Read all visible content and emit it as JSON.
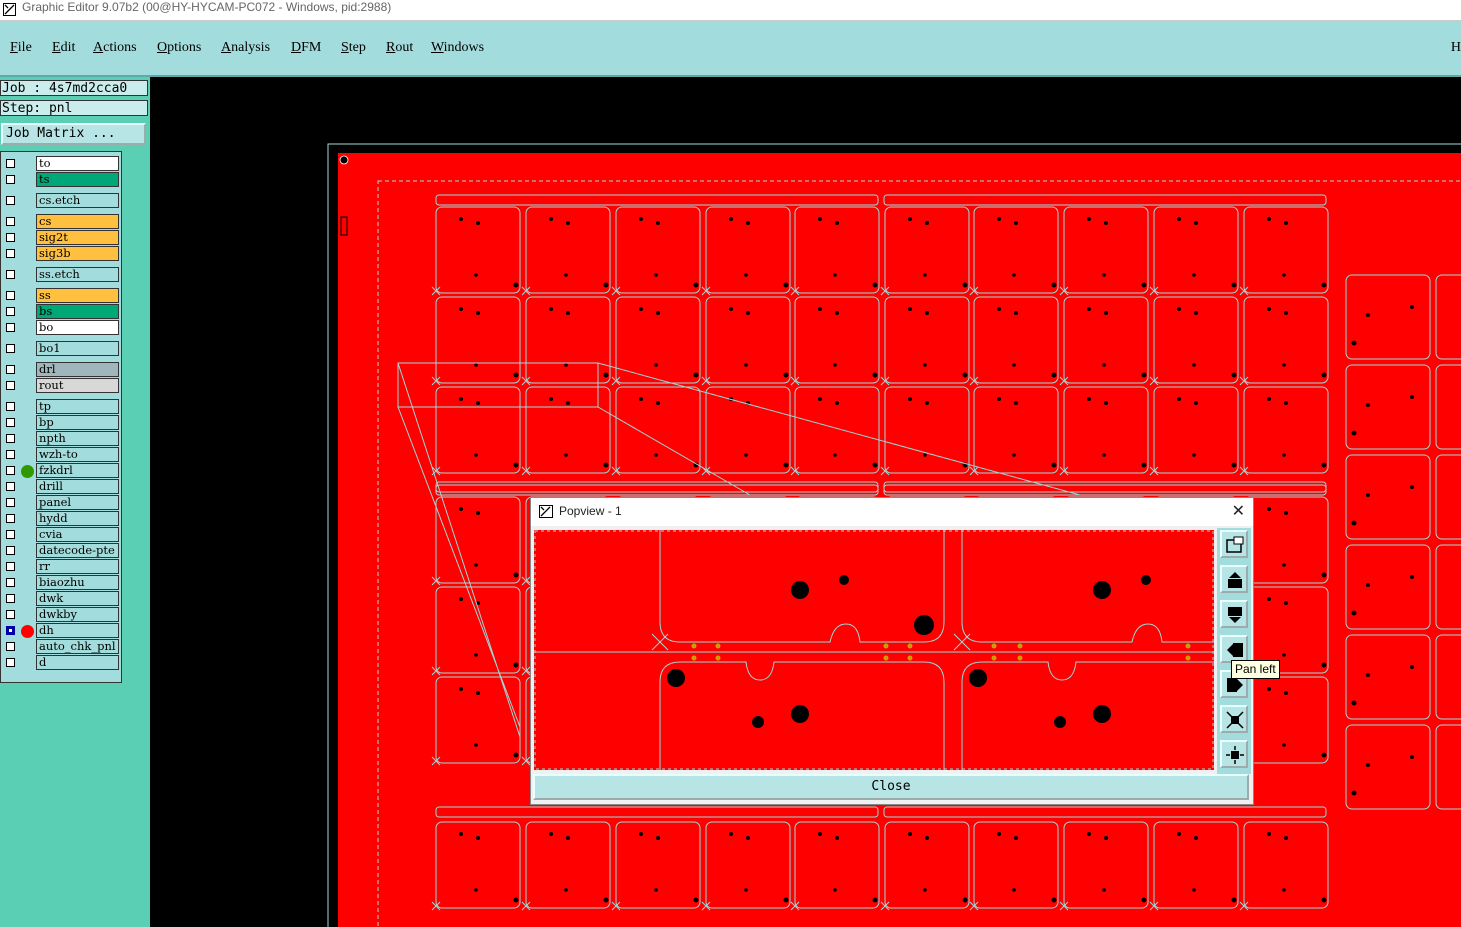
{
  "window": {
    "title": "Graphic Editor 9.07b2 (00@HY-HYCAM-PC072 - Windows, pid:2988)"
  },
  "menu": {
    "items": [
      {
        "label": "File",
        "u": "F",
        "rest": "ile"
      },
      {
        "label": "Edit",
        "u": "E",
        "rest": "dit"
      },
      {
        "label": "Actions",
        "u": "A",
        "rest": "ctions"
      },
      {
        "label": "Options",
        "u": "O",
        "rest": "ptions"
      },
      {
        "label": "Analysis",
        "u": "A",
        "rest": "nalysis"
      },
      {
        "label": "DFM",
        "u": "D",
        "rest": "FM"
      },
      {
        "label": "Step",
        "u": "S",
        "rest": "tep"
      },
      {
        "label": "Rout",
        "u": "R",
        "rest": "out"
      },
      {
        "label": "Windows",
        "u": "W",
        "rest": "indows"
      }
    ],
    "right_label": "H"
  },
  "panel": {
    "job": "Job : 4s7md2cca0",
    "step": "Step: pnl",
    "job_matrix": "Job Matrix ..."
  },
  "layers": [
    {
      "name": "to",
      "color": "#ffffff"
    },
    {
      "name": "ts",
      "color": "#00a878"
    },
    {
      "name": "cs.etch",
      "color": "#a3dcdc"
    },
    {
      "name": "cs",
      "color": "#ffc040"
    },
    {
      "name": "sig2t",
      "color": "#ffc040"
    },
    {
      "name": "sig3b",
      "color": "#ffc040"
    },
    {
      "name": "ss.etch",
      "color": "#a3dcdc"
    },
    {
      "name": "ss",
      "color": "#ffc040"
    },
    {
      "name": "bs",
      "color": "#00a878"
    },
    {
      "name": "bo",
      "color": "#ffffff"
    },
    {
      "name": "bo1",
      "color": "#a3dcdc"
    },
    {
      "name": "drl",
      "color": "#9fb6bc"
    },
    {
      "name": "rout",
      "color": "#d8d8d8"
    },
    {
      "name": "tp",
      "color": "#a3dcdc"
    },
    {
      "name": "bp",
      "color": "#a3dcdc"
    },
    {
      "name": "npth",
      "color": "#a3dcdc"
    },
    {
      "name": "wzh-to",
      "color": "#a3dcdc"
    },
    {
      "name": "fzkdrl",
      "color": "#a3dcdc",
      "dot": "#2e9a00"
    },
    {
      "name": "drill",
      "color": "#a3dcdc"
    },
    {
      "name": "panel",
      "color": "#a3dcdc"
    },
    {
      "name": "hydd",
      "color": "#a3dcdc"
    },
    {
      "name": "cvia",
      "color": "#a3dcdc"
    },
    {
      "name": "datecode-pte",
      "color": "#a3dcdc"
    },
    {
      "name": "rr",
      "color": "#a3dcdc"
    },
    {
      "name": "biaozhu",
      "color": "#a3dcdc"
    },
    {
      "name": "dwk",
      "color": "#a3dcdc"
    },
    {
      "name": "dwkby",
      "color": "#a3dcdc"
    },
    {
      "name": "dh",
      "color": "#a3dcdc",
      "dot": "#ff0000",
      "checked": true
    },
    {
      "name": "auto_chk_pnl",
      "color": "#a3dcdc"
    },
    {
      "name": "d",
      "color": "#a3dcdc"
    }
  ],
  "popview": {
    "title": "Popview - 1",
    "close_label": "Close",
    "tooltip": "Pan left",
    "tools": [
      "zoom-window-icon",
      "pan-up-icon",
      "pan-down-icon",
      "pan-left-icon",
      "pan-right-icon",
      "zoom-in-icon",
      "zoom-out-icon"
    ]
  },
  "colors": {
    "board": "#ff0000",
    "outline": "#9fd8d8",
    "menubar": "#a3dcdc",
    "panel": "#5bcfb4"
  }
}
